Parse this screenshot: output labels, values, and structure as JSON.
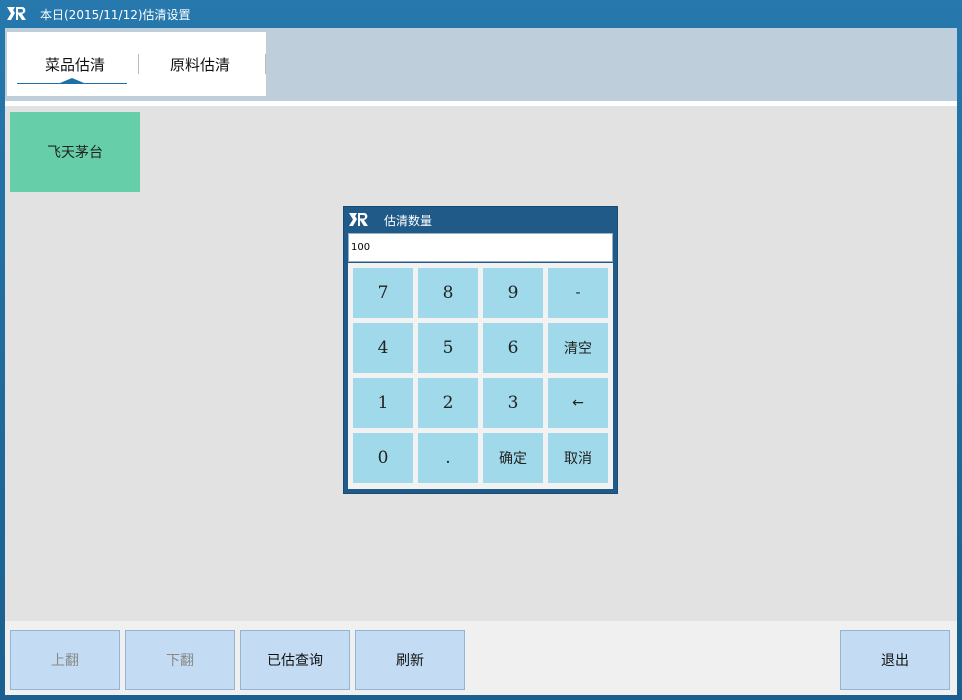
{
  "window": {
    "title": "本日(2015/11/12)估清设置"
  },
  "tabs": [
    {
      "label": "菜品估清",
      "active": true
    },
    {
      "label": "原料估清",
      "active": false
    }
  ],
  "dishes": [
    {
      "label": "飞天茅台",
      "color": "#66cfaa"
    }
  ],
  "dialog": {
    "title": "估清数量",
    "input_value": "100",
    "keys": [
      [
        "7",
        "8",
        "9",
        "-"
      ],
      [
        "4",
        "5",
        "6",
        "清空"
      ],
      [
        "1",
        "2",
        "3",
        "←"
      ],
      [
        "0",
        ".",
        "确定",
        "取消"
      ]
    ]
  },
  "footer": {
    "prev_page": "上翻",
    "next_page": "下翻",
    "query": "已估查询",
    "refresh": "刷新",
    "exit": "退出"
  },
  "colors": {
    "titlebar": "#1f6a9e",
    "accent": "#1d6fa6",
    "dish_green": "#66cfaa",
    "key_blue": "#9fd9ea",
    "footer_button": "#c3dcf3"
  }
}
